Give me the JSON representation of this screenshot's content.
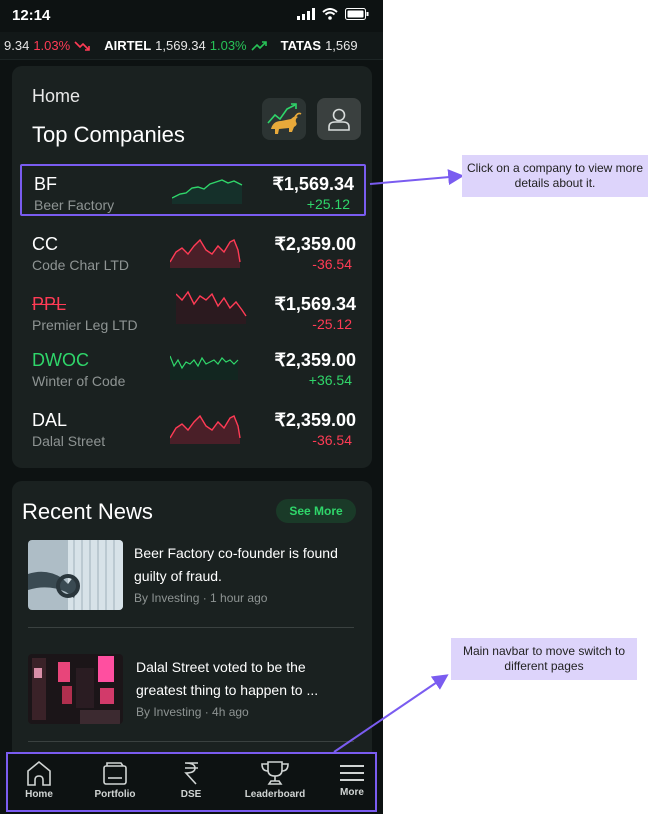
{
  "status_bar": {
    "time": "12:14"
  },
  "ticker": [
    {
      "symbol": "",
      "price": "9.34",
      "change": "1.03%",
      "direction": "down"
    },
    {
      "symbol": "AIRTEL",
      "price": "1,569.34",
      "change": "1.03%",
      "direction": "up"
    },
    {
      "symbol": "TATAS",
      "price": "1,569",
      "change": "",
      "direction": ""
    }
  ],
  "home": {
    "label": "Home",
    "title": "Top Companies"
  },
  "companies": [
    {
      "symbol": "BF",
      "name": "Beer Factory",
      "price": "₹1,569.34",
      "change": "+25.12",
      "trend": "up",
      "style": "normal"
    },
    {
      "symbol": "CC",
      "name": "Code Char LTD",
      "price": "₹2,359.00",
      "change": "-36.54",
      "trend": "down",
      "style": "normal"
    },
    {
      "symbol": "PPL",
      "name": "Premier Leg LTD",
      "price": "₹1,569.34",
      "change": "-25.12",
      "trend": "down",
      "style": "struck"
    },
    {
      "symbol": "DWOC",
      "name": "Winter of Code",
      "price": "₹2,359.00",
      "change": "+36.54",
      "trend": "up",
      "style": "green"
    },
    {
      "symbol": "DAL",
      "name": "Dalal Street",
      "price": "₹2,359.00",
      "change": "-36.54",
      "trend": "down",
      "style": "normal"
    }
  ],
  "news": {
    "title": "Recent News",
    "see_more": "See More",
    "items": [
      {
        "headline": "Beer Factory co-founder  is found guilty of fraud.",
        "meta": "By Investing · 1 hour ago"
      },
      {
        "headline": "Dalal Street voted to be the greatest thing to happen to ...",
        "meta": "By Investing · 4h ago"
      }
    ]
  },
  "navbar": [
    {
      "label": "Home",
      "icon": "home-icon"
    },
    {
      "label": "Portfolio",
      "icon": "portfolio-icon"
    },
    {
      "label": "DSE",
      "icon": "rupee-icon"
    },
    {
      "label": "Leaderboard",
      "icon": "trophy-icon"
    },
    {
      "label": "More",
      "icon": "menu-icon"
    }
  ],
  "annotations": {
    "company_hint": "Click on a company to view more details about it.",
    "navbar_hint": "Main navbar to move switch to different pages"
  },
  "colors": {
    "background": "#0d1212",
    "card": "#1a2120",
    "up": "#2fd66a",
    "down": "#ff3b55",
    "highlight": "#7a5cf0",
    "annotation": "#ddd4fb"
  }
}
